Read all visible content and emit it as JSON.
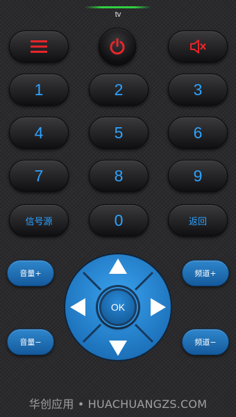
{
  "header": {
    "device_name": "tv"
  },
  "top_row": {
    "menu_icon": "menu-icon",
    "power_icon": "power-icon",
    "mute_icon": "mute-icon",
    "icon_color": "#e8262a"
  },
  "keypad": {
    "k1": "1",
    "k2": "2",
    "k3": "3",
    "k4": "4",
    "k5": "5",
    "k6": "6",
    "k7": "7",
    "k8": "8",
    "k9": "9",
    "source": "信号源",
    "k0": "0",
    "back": "返回",
    "text_color": "#2da3ff"
  },
  "side_buttons": {
    "volume_up": "音量+",
    "volume_down": "音量−",
    "channel_up": "频道+",
    "channel_down": "频道−"
  },
  "dpad": {
    "ok": "OK",
    "ring_color": "#2b8fdc"
  },
  "watermark": "华创应用 • HUACHUANGZS.COM"
}
